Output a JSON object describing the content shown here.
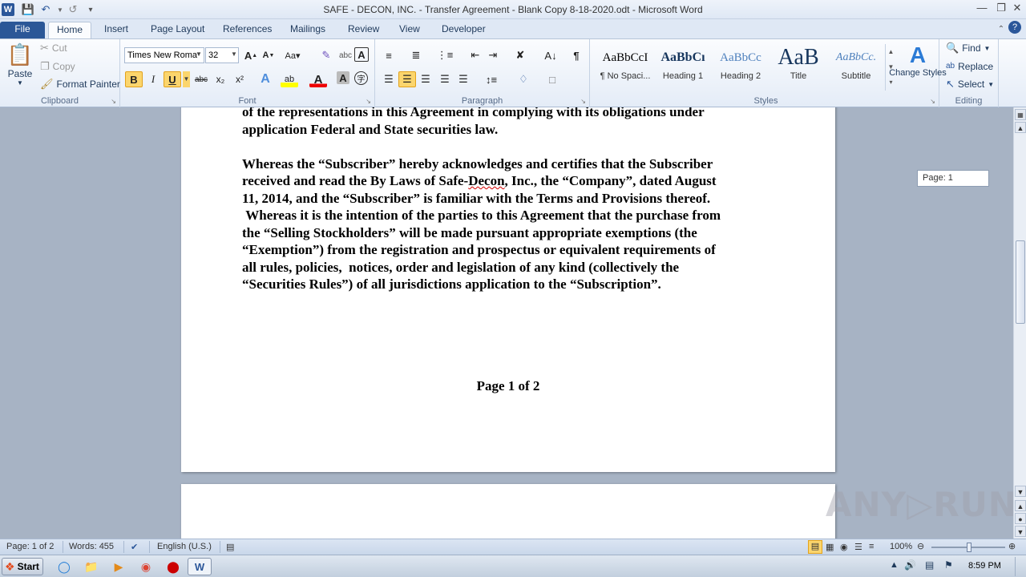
{
  "titlebar": {
    "title": "SAFE - DECON, INC. - Transfer Agreement - Blank Copy 8-18-2020.odt - Microsoft Word",
    "app_icon": "W"
  },
  "tabs": [
    {
      "label": "File"
    },
    {
      "label": "Home"
    },
    {
      "label": "Insert"
    },
    {
      "label": "Page Layout"
    },
    {
      "label": "References"
    },
    {
      "label": "Mailings"
    },
    {
      "label": "Review"
    },
    {
      "label": "View"
    },
    {
      "label": "Developer"
    }
  ],
  "clipboard": {
    "paste": "Paste",
    "cut": "Cut",
    "copy": "Copy",
    "format_painter": "Format Painter",
    "label": "Clipboard"
  },
  "font": {
    "name": "Times New Roma",
    "size": "32",
    "label": "Font",
    "bold": "B",
    "italic": "I",
    "underline": "U",
    "strike": "abc",
    "subscript": "x₂",
    "superscript": "x²",
    "font_color": "A",
    "highlight": "ab"
  },
  "paragraph": {
    "label": "Paragraph"
  },
  "styles": {
    "label": "Styles",
    "items": [
      {
        "sample": "AaBbCcI",
        "name": "¶ No Spaci..."
      },
      {
        "sample": "AaBbCı",
        "name": "Heading 1"
      },
      {
        "sample": "AaBbCc",
        "name": "Heading 2"
      },
      {
        "sample": "AaB",
        "name": "Title"
      },
      {
        "sample": "AaBbCc.",
        "name": "Subtitle"
      }
    ],
    "change_styles": "Change Styles"
  },
  "editing": {
    "find": "Find",
    "replace": "Replace",
    "select": "Select",
    "label": "Editing"
  },
  "document": {
    "cut_line": "of the representations in this Agreement in complying with its obligations under",
    "line_law": "application Federal and State securities law.",
    "p2_l1": "Whereas the “Subscriber” hereby acknowledges and certifies that the Subscriber",
    "p2_l2a": "received and read the By Laws of Safe-",
    "p2_l2b": "Decon",
    "p2_l2c": ", Inc., the “Company”, dated August",
    "p2_l3": "11, 2014, and the “Subscriber” is familiar with the Terms and Provisions thereof.",
    "p2_l4": " Whereas it is the intention of the parties to this Agreement that the purchase from",
    "p2_l5": "the “Selling Stockholders” will be made pursuant appropriate exemptions (the",
    "p2_l6": "“Exemption”) from the registration and prospectus or equivalent requirements of",
    "p2_l7": "all rules, policies,  notices, order and legislation of any kind (collectively the",
    "p2_l8": "“Securities Rules”) of all jurisdictions application to the “Subscription”.",
    "page_footer": "Page 1 of 2"
  },
  "page_tooltip": "Page: 1",
  "statusbar": {
    "page": "Page: 1 of 2",
    "words": "Words: 455",
    "language": "English (U.S.)",
    "zoom": "100%"
  },
  "taskbar": {
    "start": "Start",
    "clock": "8:59 PM"
  },
  "watermark": "ANY▷RUN"
}
